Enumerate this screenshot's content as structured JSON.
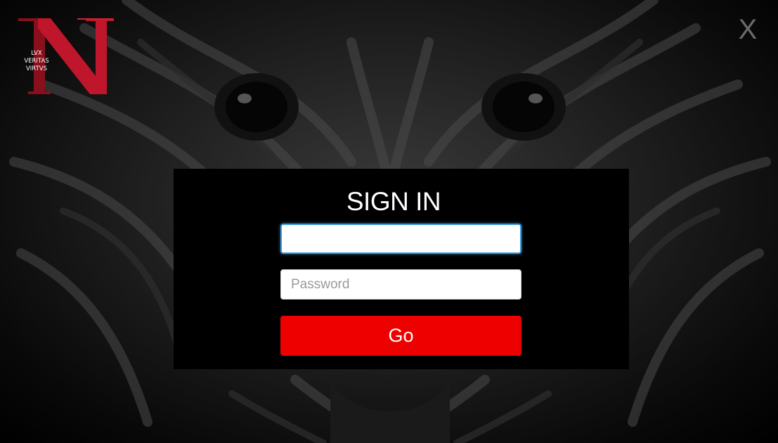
{
  "logo": {
    "letter": "N",
    "motto_lines": [
      "LVX",
      "VERITAS",
      "VIRTVS"
    ]
  },
  "close": {
    "label": "X"
  },
  "signin": {
    "title": "SIGN IN",
    "username_value": "",
    "password_placeholder": "Password",
    "submit_label": "Go"
  },
  "colors": {
    "accent": "#ee0000",
    "focus_ring": "#3b97d9",
    "panel": "#000000",
    "close": "#6b6b6b"
  }
}
